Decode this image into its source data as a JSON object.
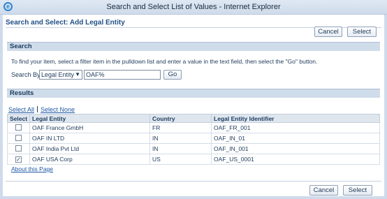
{
  "window": {
    "title": "Search and Select List of Values - Internet Explorer"
  },
  "page": {
    "title": "Search and Select: Add Legal Entity"
  },
  "buttons": {
    "cancel": "Cancel",
    "select": "Select",
    "go": "Go"
  },
  "search_section": {
    "header": "Search",
    "instructions": "To find your item, select a filter item in the pulldown list and enter a value in the text field, then select the \"Go\" button.",
    "search_by_label": "Search By",
    "filter_selected": "Legal Entity",
    "value": "OAF%"
  },
  "results_section": {
    "header": "Results",
    "select_all": "Select All",
    "select_none": "Select None",
    "columns": [
      "Select",
      "Legal Entity",
      "Country",
      "Legal Entity Identifier"
    ],
    "rows": [
      {
        "checked": false,
        "entity": "OAF France GmbH",
        "country": "FR",
        "identifier": "OAF_FR_001"
      },
      {
        "checked": false,
        "entity": "OAF IN LTD",
        "country": "IN",
        "identifier": "OAF_IN_01"
      },
      {
        "checked": false,
        "entity": "OAF India Pvt Ltd",
        "country": "IN",
        "identifier": "OAF_IN_001"
      },
      {
        "checked": true,
        "entity": "OAF USA Corp",
        "country": "US",
        "identifier": "OAF_US_0001"
      }
    ]
  },
  "footer": {
    "about": "About this Page"
  }
}
